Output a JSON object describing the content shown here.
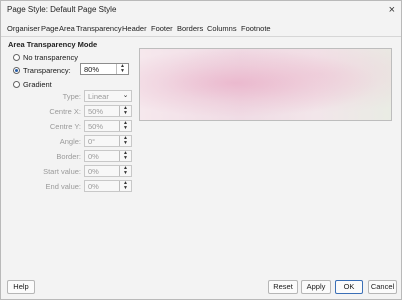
{
  "window": {
    "title": "Page Style: Default Page Style",
    "close_glyph": "×"
  },
  "tabs": [
    "Organiser",
    "Page",
    "Area",
    "Transparency",
    "Header",
    "Footer",
    "Borders",
    "Columns",
    "Footnote"
  ],
  "panel": {
    "section_title": "Area Transparency Mode",
    "no_transparency": "No transparency",
    "transparency": "Transparency:",
    "transparency_value": "80%",
    "gradient": "Gradient",
    "type_label": "Type:",
    "type_value": "Linear",
    "centre_x_label": "Centre X:",
    "centre_x_value": "50%",
    "centre_y_label": "Centre Y:",
    "centre_y_value": "50%",
    "angle_label": "Angle:",
    "angle_value": "0°",
    "border_label": "Border:",
    "border_value": "0%",
    "start_label": "Start value:",
    "start_value": "0%",
    "end_label": "End value:",
    "end_value": "0%"
  },
  "buttons": {
    "help": "Help",
    "reset": "Reset",
    "apply": "Apply",
    "ok": "OK",
    "cancel": "Cancel"
  },
  "colors": {
    "accent": "#2b5fa8",
    "ok_border": "#3b6fb6"
  }
}
